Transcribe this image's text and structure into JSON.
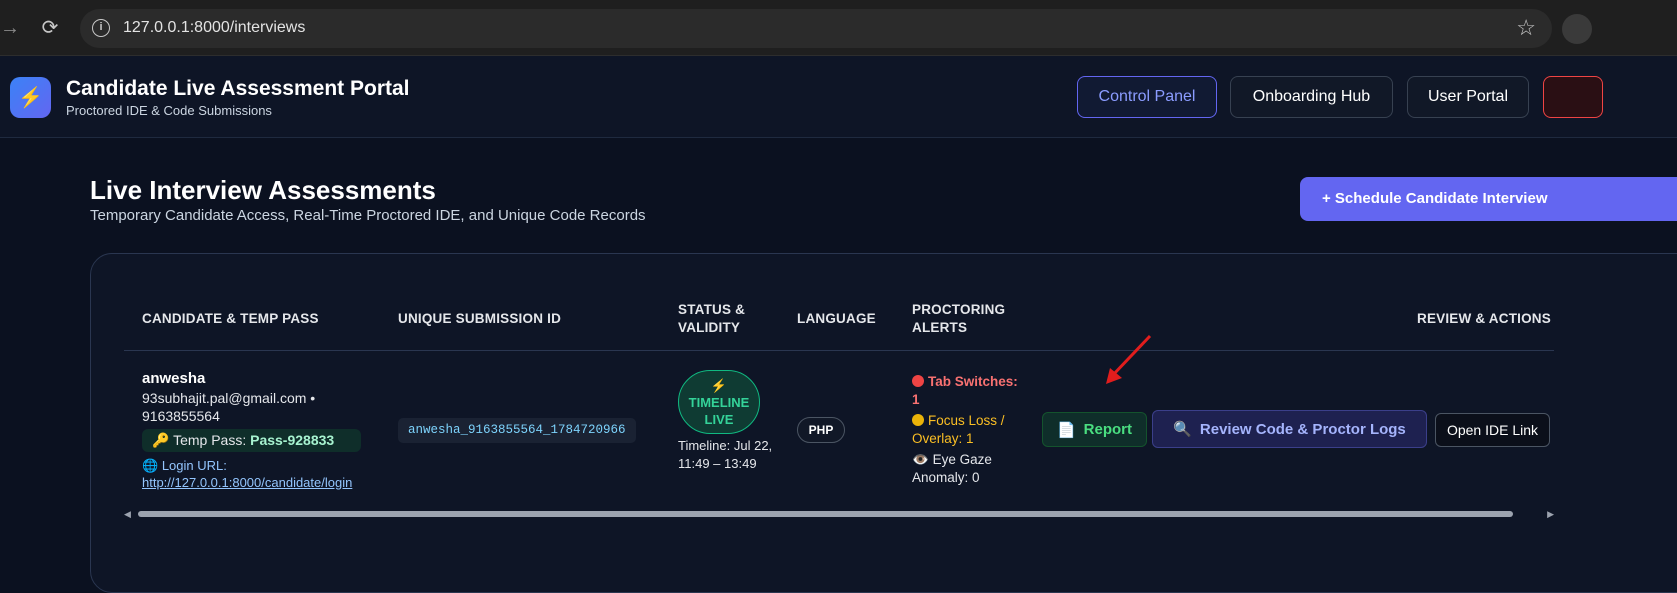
{
  "browser": {
    "url": "127.0.0.1:8000/interviews"
  },
  "header": {
    "title": "Candidate Live Assessment Portal",
    "subtitle": "Proctored IDE & Code Submissions",
    "nav": [
      "Control Panel",
      "Onboarding Hub",
      "User Portal"
    ]
  },
  "page": {
    "title": "Live Interview Assessments",
    "subtitle": "Temporary Candidate Access, Real-Time Proctored IDE, and Unique Code Records",
    "schedule_label": "+ Schedule Candidate Interview"
  },
  "table": {
    "headers": {
      "candidate": "CANDIDATE & TEMP PASS",
      "submission": "UNIQUE SUBMISSION ID",
      "status_1": "STATUS &",
      "status_2": "VALIDITY",
      "language": "LANGUAGE",
      "alerts_1": "PROCTORING",
      "alerts_2": "ALERTS",
      "actions": "REVIEW & ACTIONS"
    },
    "row": {
      "name": "anwesha",
      "contact": "93subhajit.pal@gmail.com • 9163855564",
      "temp_pass_label": "Temp Pass: ",
      "temp_pass": "Pass-928833",
      "login_label": "Login URL:",
      "login_url": "http://127.0.0.1:8000/candidate/login",
      "submission_id": "anwesha_9163855564_1784720966",
      "status_line1": "TIMELINE",
      "status_line2": "LIVE",
      "timeline": "Timeline: Jul 22, 11:49 – 13:49",
      "language": "PHP",
      "alert_tab": "Tab Switches: 1",
      "alert_focus": "Focus Loss / Overlay: 1",
      "alert_gaze": "Eye Gaze Anomaly: 0",
      "report_label": "Report",
      "review_label": "Review Code & Proctor Logs",
      "ide_label": "Open IDE Link"
    }
  },
  "colors": {
    "accent": "#6366f1",
    "live": "#34d399",
    "alert_red": "#f87171",
    "alert_yellow": "#fbbf24"
  }
}
